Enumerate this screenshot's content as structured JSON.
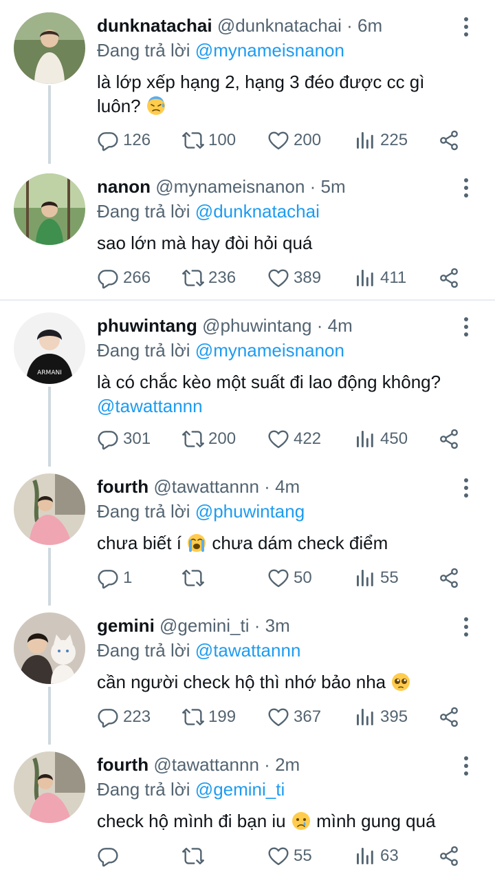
{
  "tweets": [
    {
      "name": "dunknatachai",
      "handle": "@dunknatachai",
      "dot": "·",
      "time": "6m",
      "reply_prefix": "Đang trả lời",
      "reply_to": "@mynameisnanon",
      "text": "là lớp xếp hạng 2, hạng 3 đéo được cc gì luôn?",
      "emoji": "downcast-sweat-emoji",
      "counts": {
        "reply": "126",
        "retweet": "100",
        "like": "200",
        "views": "225"
      }
    },
    {
      "name": "nanon",
      "handle": "@mynameisnanon",
      "dot": "·",
      "time": "5m",
      "reply_prefix": "Đang trả lời",
      "reply_to": "@dunknatachai",
      "text": "sao lớn mà hay đòi hỏi quá",
      "counts": {
        "reply": "266",
        "retweet": "236",
        "like": "389",
        "views": "411"
      }
    },
    {
      "name": "phuwintang",
      "handle": "@phuwintang",
      "dot": "·",
      "time": "4m",
      "reply_prefix": "Đang trả lời",
      "reply_to": "@mynameisnanon",
      "text": "là có chắc kèo một suất đi lao động không?",
      "mention": "@tawattannn",
      "counts": {
        "reply": "301",
        "retweet": "200",
        "like": "422",
        "views": "450"
      }
    },
    {
      "name": "fourth",
      "handle": "@tawattannn",
      "dot": "·",
      "time": "4m",
      "reply_prefix": "Đang trả lời",
      "reply_to": "@phuwintang",
      "text_before": "chưa biết í",
      "text_after": "chưa dám check điểm",
      "emoji": "loudly-crying-emoji",
      "counts": {
        "reply": "1",
        "retweet": "",
        "like": "50",
        "views": "55"
      }
    },
    {
      "name": "gemini",
      "handle": "@gemini_ti",
      "dot": "·",
      "time": "3m",
      "reply_prefix": "Đang trả lời",
      "reply_to": "@tawattannn",
      "text": "cần người check hộ thì nhớ bảo nha",
      "emoji": "pleading-face-emoji",
      "counts": {
        "reply": "223",
        "retweet": "199",
        "like": "367",
        "views": "395"
      }
    },
    {
      "name": "fourth",
      "handle": "@tawattannn",
      "dot": "·",
      "time": "2m",
      "reply_prefix": "Đang trả lời",
      "reply_to": "@gemini_ti",
      "text_before": "check hộ mình đi bạn iu",
      "text_after": "mình gung quá",
      "emoji": "crying-face-emoji",
      "counts": {
        "reply": "",
        "retweet": "",
        "like": "55",
        "views": "63"
      }
    }
  ],
  "colors": {
    "link": "#1d9bf0",
    "secondary": "#536471",
    "text": "#0f1419",
    "thread_line": "#cfd9de"
  }
}
